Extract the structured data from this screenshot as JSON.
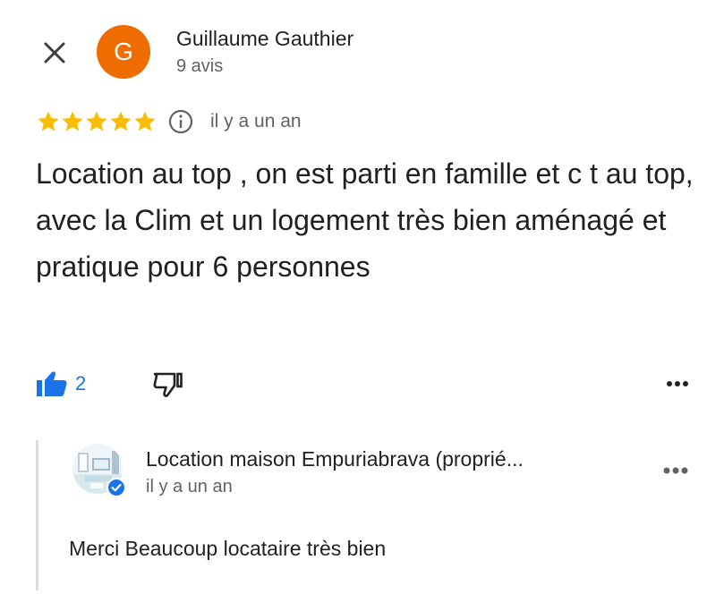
{
  "header": {
    "close_icon": "close-icon",
    "avatar_initial": "G",
    "avatar_color": "#ef6c00",
    "author_name": "Guillaume Gauthier",
    "author_meta": "9 avis"
  },
  "review": {
    "rating": 5,
    "rating_max": 5,
    "star_color": "#fbbc04",
    "info_icon": "info-icon",
    "date": "il y a un an",
    "text": "Location au top , on est parti en famille et c t au top, avec la Clim et un logement très bien aménagé et pratique pour 6 personnes"
  },
  "actions": {
    "like_count": "2",
    "like_icon": "thumb-up-icon",
    "dislike_icon": "thumb-down-icon",
    "more_icon": "more-horiz-icon",
    "accent_color": "#1a73e8"
  },
  "owner_reply": {
    "name": "Location maison Empuriabrava (proprié...",
    "date": "il y a un an",
    "text": "Merci Beaucoup locataire très bien",
    "verified_icon": "verified-badge-icon",
    "more_icon": "more-horiz-icon"
  }
}
